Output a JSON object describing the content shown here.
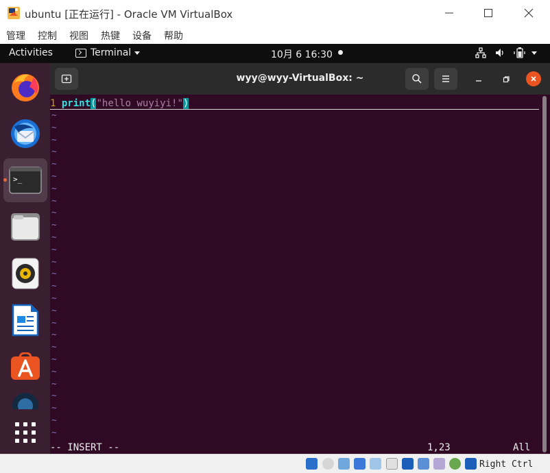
{
  "host_window": {
    "title": "ubuntu [正在运行] - Oracle VM VirtualBox",
    "menu": [
      "管理",
      "控制",
      "视图",
      "热键",
      "设备",
      "帮助"
    ]
  },
  "gnome_topbar": {
    "activities": "Activities",
    "app_menu": "Terminal",
    "clock": "10月 6  16:30"
  },
  "dock": {
    "items": [
      {
        "name": "firefox",
        "running": false
      },
      {
        "name": "thunderbird",
        "running": false
      },
      {
        "name": "terminal",
        "running": true
      },
      {
        "name": "files",
        "running": false
      },
      {
        "name": "rhythmbox",
        "running": false
      },
      {
        "name": "libreoffice-writer",
        "running": false
      },
      {
        "name": "ubuntu-software",
        "running": false
      },
      {
        "name": "help",
        "running": false
      }
    ],
    "show_apps": "show-applications"
  },
  "terminal": {
    "title": "wyy@wyy-VirtualBox: ~",
    "vim": {
      "line_number": "1",
      "code_keyword": "print",
      "code_open": "(",
      "code_string": "\"hello wuyiyi!\"",
      "code_close": ")",
      "empty_marker": "~",
      "mode": "-- INSERT --",
      "position": "1,23",
      "scroll": "All"
    }
  },
  "host_statusbar": {
    "host_key": "Right Ctrl"
  },
  "colors": {
    "ubuntu_orange": "#e95420",
    "terminal_bg": "#300a24",
    "vim_keyword": "#34e2e2",
    "vim_string": "#ad7fa8",
    "vim_linenr": "#c4a000"
  }
}
